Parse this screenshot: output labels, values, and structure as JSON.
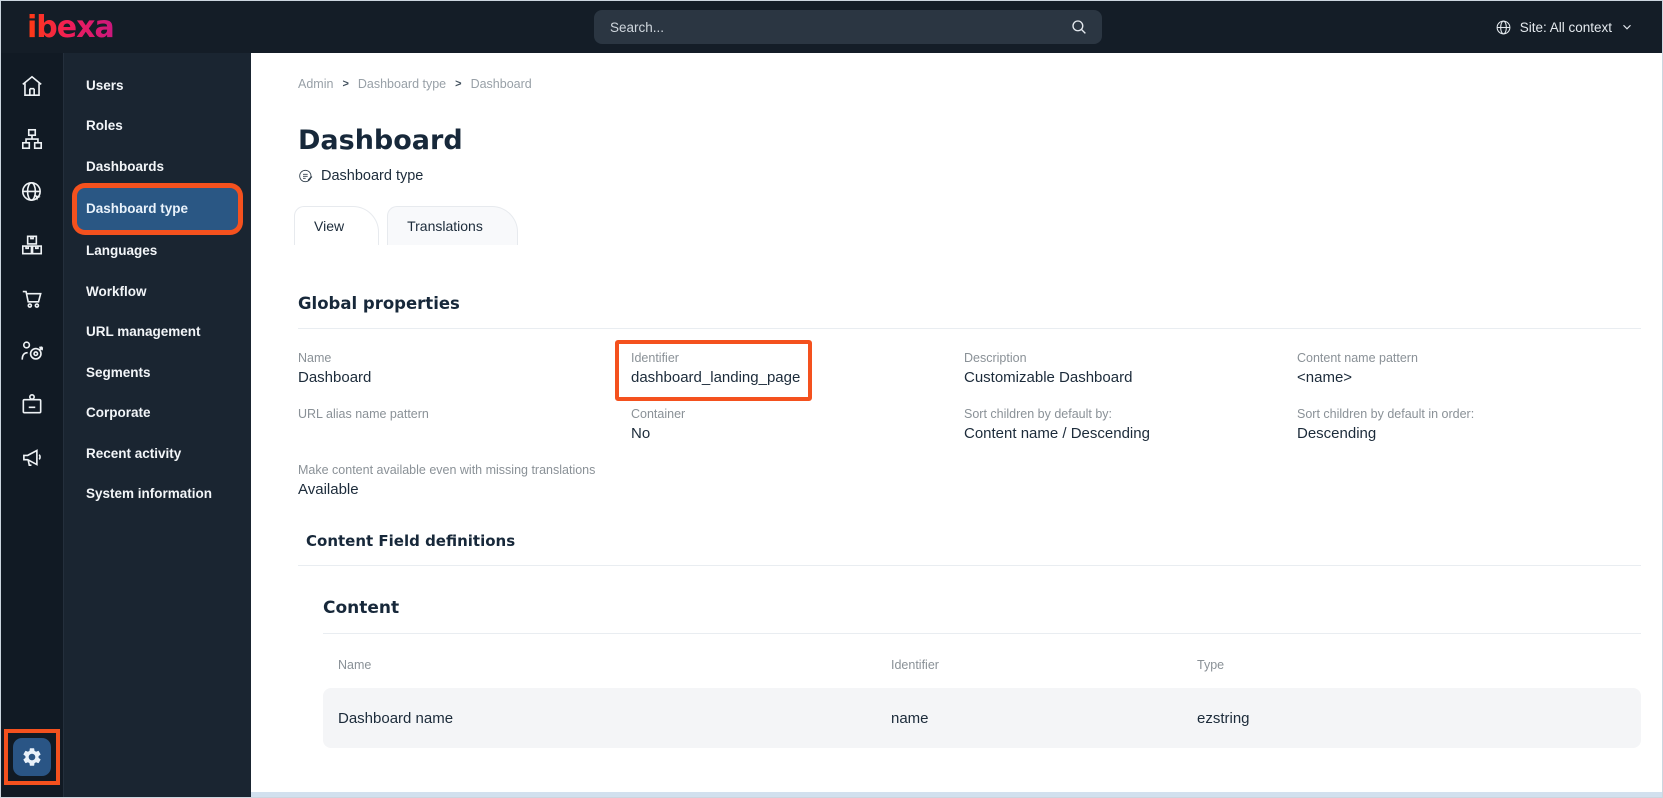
{
  "topbar": {
    "logo": "ibexa",
    "search_placeholder": "Search...",
    "site_context": "Site: All context",
    "icons": [
      "search-icon",
      "globe-icon",
      "chevron-down-icon"
    ]
  },
  "rail": {
    "icons": [
      "home-icon",
      "content-tree-icon",
      "site-globe-icon",
      "products-icon",
      "commerce-cart-icon",
      "personalization-target-icon",
      "corporate-badge-icon",
      "marketing-megaphone-icon",
      "settings-gear-icon"
    ]
  },
  "sidebar": {
    "items": [
      {
        "label": "Users",
        "selected": false
      },
      {
        "label": "Roles",
        "selected": false
      },
      {
        "label": "Dashboards",
        "selected": false
      },
      {
        "label": "Dashboard type",
        "selected": true
      },
      {
        "label": "Languages",
        "selected": false
      },
      {
        "label": "Workflow",
        "selected": false
      },
      {
        "label": "URL management",
        "selected": false
      },
      {
        "label": "Segments",
        "selected": false
      },
      {
        "label": "Corporate",
        "selected": false
      },
      {
        "label": "Recent activity",
        "selected": false
      },
      {
        "label": "System information",
        "selected": false
      }
    ]
  },
  "breadcrumb": {
    "items": [
      "Admin",
      "Dashboard type",
      "Dashboard"
    ],
    "separator": ">"
  },
  "page": {
    "title": "Dashboard",
    "subtitle": "Dashboard type",
    "tabs": [
      {
        "label": "View",
        "active": true
      },
      {
        "label": "Translations",
        "active": false
      }
    ]
  },
  "global_properties": {
    "heading": "Global properties",
    "fields": [
      {
        "label": "Name",
        "value": "Dashboard"
      },
      {
        "label": "Identifier",
        "value": "dashboard_landing_page",
        "highlighted": true
      },
      {
        "label": "Description",
        "value": "Customizable Dashboard"
      },
      {
        "label": "Content name pattern",
        "value": "<name>"
      },
      {
        "label": "URL alias name pattern",
        "value": ""
      },
      {
        "label": "Container",
        "value": "No"
      },
      {
        "label": "Sort children by default by:",
        "value": "Content name / Descending"
      },
      {
        "label": "Sort children by default in order:",
        "value": "Descending"
      },
      {
        "label": "Make content available even with missing translations",
        "value": "Available"
      }
    ]
  },
  "field_definitions": {
    "heading": "Content Field definitions",
    "group": "Content",
    "table": {
      "headers": [
        "Name",
        "Identifier",
        "Type"
      ],
      "rows": [
        [
          "Dashboard name",
          "name",
          "ezstring"
        ]
      ]
    }
  },
  "colors": {
    "annotation_orange": "#f4511e",
    "selected_item_blue": "#2a5784",
    "topbar_dark": "#141d27",
    "sidebar_dark": "#1a2531",
    "row_gray": "#f4f5f7"
  }
}
